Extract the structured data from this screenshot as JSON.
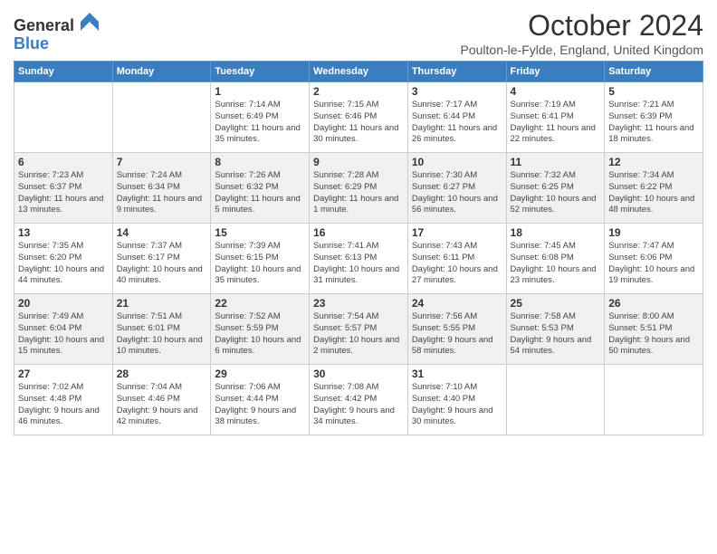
{
  "header": {
    "logo_general": "General",
    "logo_blue": "Blue",
    "month_title": "October 2024",
    "subtitle": "Poulton-le-Fylde, England, United Kingdom"
  },
  "days_of_week": [
    "Sunday",
    "Monday",
    "Tuesday",
    "Wednesday",
    "Thursday",
    "Friday",
    "Saturday"
  ],
  "weeks": [
    [
      {
        "day": "",
        "sunrise": "",
        "sunset": "",
        "daylight": ""
      },
      {
        "day": "",
        "sunrise": "",
        "sunset": "",
        "daylight": ""
      },
      {
        "day": "1",
        "sunrise": "Sunrise: 7:14 AM",
        "sunset": "Sunset: 6:49 PM",
        "daylight": "Daylight: 11 hours and 35 minutes."
      },
      {
        "day": "2",
        "sunrise": "Sunrise: 7:15 AM",
        "sunset": "Sunset: 6:46 PM",
        "daylight": "Daylight: 11 hours and 30 minutes."
      },
      {
        "day": "3",
        "sunrise": "Sunrise: 7:17 AM",
        "sunset": "Sunset: 6:44 PM",
        "daylight": "Daylight: 11 hours and 26 minutes."
      },
      {
        "day": "4",
        "sunrise": "Sunrise: 7:19 AM",
        "sunset": "Sunset: 6:41 PM",
        "daylight": "Daylight: 11 hours and 22 minutes."
      },
      {
        "day": "5",
        "sunrise": "Sunrise: 7:21 AM",
        "sunset": "Sunset: 6:39 PM",
        "daylight": "Daylight: 11 hours and 18 minutes."
      }
    ],
    [
      {
        "day": "6",
        "sunrise": "Sunrise: 7:23 AM",
        "sunset": "Sunset: 6:37 PM",
        "daylight": "Daylight: 11 hours and 13 minutes."
      },
      {
        "day": "7",
        "sunrise": "Sunrise: 7:24 AM",
        "sunset": "Sunset: 6:34 PM",
        "daylight": "Daylight: 11 hours and 9 minutes."
      },
      {
        "day": "8",
        "sunrise": "Sunrise: 7:26 AM",
        "sunset": "Sunset: 6:32 PM",
        "daylight": "Daylight: 11 hours and 5 minutes."
      },
      {
        "day": "9",
        "sunrise": "Sunrise: 7:28 AM",
        "sunset": "Sunset: 6:29 PM",
        "daylight": "Daylight: 11 hours and 1 minute."
      },
      {
        "day": "10",
        "sunrise": "Sunrise: 7:30 AM",
        "sunset": "Sunset: 6:27 PM",
        "daylight": "Daylight: 10 hours and 56 minutes."
      },
      {
        "day": "11",
        "sunrise": "Sunrise: 7:32 AM",
        "sunset": "Sunset: 6:25 PM",
        "daylight": "Daylight: 10 hours and 52 minutes."
      },
      {
        "day": "12",
        "sunrise": "Sunrise: 7:34 AM",
        "sunset": "Sunset: 6:22 PM",
        "daylight": "Daylight: 10 hours and 48 minutes."
      }
    ],
    [
      {
        "day": "13",
        "sunrise": "Sunrise: 7:35 AM",
        "sunset": "Sunset: 6:20 PM",
        "daylight": "Daylight: 10 hours and 44 minutes."
      },
      {
        "day": "14",
        "sunrise": "Sunrise: 7:37 AM",
        "sunset": "Sunset: 6:17 PM",
        "daylight": "Daylight: 10 hours and 40 minutes."
      },
      {
        "day": "15",
        "sunrise": "Sunrise: 7:39 AM",
        "sunset": "Sunset: 6:15 PM",
        "daylight": "Daylight: 10 hours and 35 minutes."
      },
      {
        "day": "16",
        "sunrise": "Sunrise: 7:41 AM",
        "sunset": "Sunset: 6:13 PM",
        "daylight": "Daylight: 10 hours and 31 minutes."
      },
      {
        "day": "17",
        "sunrise": "Sunrise: 7:43 AM",
        "sunset": "Sunset: 6:11 PM",
        "daylight": "Daylight: 10 hours and 27 minutes."
      },
      {
        "day": "18",
        "sunrise": "Sunrise: 7:45 AM",
        "sunset": "Sunset: 6:08 PM",
        "daylight": "Daylight: 10 hours and 23 minutes."
      },
      {
        "day": "19",
        "sunrise": "Sunrise: 7:47 AM",
        "sunset": "Sunset: 6:06 PM",
        "daylight": "Daylight: 10 hours and 19 minutes."
      }
    ],
    [
      {
        "day": "20",
        "sunrise": "Sunrise: 7:49 AM",
        "sunset": "Sunset: 6:04 PM",
        "daylight": "Daylight: 10 hours and 15 minutes."
      },
      {
        "day": "21",
        "sunrise": "Sunrise: 7:51 AM",
        "sunset": "Sunset: 6:01 PM",
        "daylight": "Daylight: 10 hours and 10 minutes."
      },
      {
        "day": "22",
        "sunrise": "Sunrise: 7:52 AM",
        "sunset": "Sunset: 5:59 PM",
        "daylight": "Daylight: 10 hours and 6 minutes."
      },
      {
        "day": "23",
        "sunrise": "Sunrise: 7:54 AM",
        "sunset": "Sunset: 5:57 PM",
        "daylight": "Daylight: 10 hours and 2 minutes."
      },
      {
        "day": "24",
        "sunrise": "Sunrise: 7:56 AM",
        "sunset": "Sunset: 5:55 PM",
        "daylight": "Daylight: 9 hours and 58 minutes."
      },
      {
        "day": "25",
        "sunrise": "Sunrise: 7:58 AM",
        "sunset": "Sunset: 5:53 PM",
        "daylight": "Daylight: 9 hours and 54 minutes."
      },
      {
        "day": "26",
        "sunrise": "Sunrise: 8:00 AM",
        "sunset": "Sunset: 5:51 PM",
        "daylight": "Daylight: 9 hours and 50 minutes."
      }
    ],
    [
      {
        "day": "27",
        "sunrise": "Sunrise: 7:02 AM",
        "sunset": "Sunset: 4:48 PM",
        "daylight": "Daylight: 9 hours and 46 minutes."
      },
      {
        "day": "28",
        "sunrise": "Sunrise: 7:04 AM",
        "sunset": "Sunset: 4:46 PM",
        "daylight": "Daylight: 9 hours and 42 minutes."
      },
      {
        "day": "29",
        "sunrise": "Sunrise: 7:06 AM",
        "sunset": "Sunset: 4:44 PM",
        "daylight": "Daylight: 9 hours and 38 minutes."
      },
      {
        "day": "30",
        "sunrise": "Sunrise: 7:08 AM",
        "sunset": "Sunset: 4:42 PM",
        "daylight": "Daylight: 9 hours and 34 minutes."
      },
      {
        "day": "31",
        "sunrise": "Sunrise: 7:10 AM",
        "sunset": "Sunset: 4:40 PM",
        "daylight": "Daylight: 9 hours and 30 minutes."
      },
      {
        "day": "",
        "sunrise": "",
        "sunset": "",
        "daylight": ""
      },
      {
        "day": "",
        "sunrise": "",
        "sunset": "",
        "daylight": ""
      }
    ]
  ]
}
